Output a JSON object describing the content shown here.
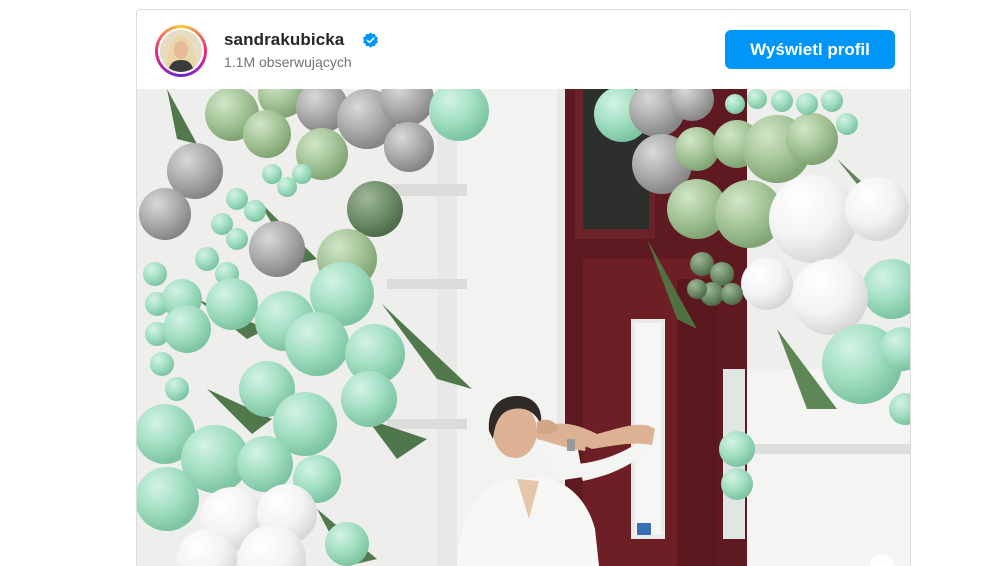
{
  "post": {
    "username": "sandrakubicka",
    "followers": "1.1M obserwujących",
    "view_profile_label": "Wyświetl profil"
  },
  "icons": {
    "verified": "verified-badge-icon",
    "avatar": "profile-avatar"
  },
  "colors": {
    "button": "#0095f6",
    "verified": "#0095f6",
    "door": "#6b1f25",
    "balloon_mint": "#9fdcbf",
    "balloon_sage": "#a9c8a0",
    "balloon_grey": "#a6a6a6"
  },
  "photo": {
    "description_alt": ""
  }
}
